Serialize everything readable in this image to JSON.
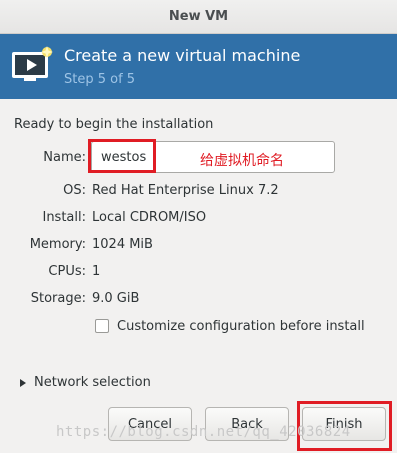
{
  "window": {
    "title": "New VM"
  },
  "banner": {
    "title": "Create a new virtual machine",
    "step": "Step 5 of 5",
    "icon": "monitor-play-icon"
  },
  "summary": {
    "heading": "Ready to begin the installation",
    "name_label": "Name:",
    "name_value": "westos",
    "os_label": "OS:",
    "os_value": "Red Hat Enterprise Linux 7.2",
    "install_label": "Install:",
    "install_value": "Local CDROM/ISO",
    "memory_label": "Memory:",
    "memory_value": "1024 MiB",
    "cpus_label": "CPUs:",
    "cpus_value": "1",
    "storage_label": "Storage:",
    "storage_value": "9.0 GiB"
  },
  "customize": {
    "label": "Customize configuration before install",
    "checked": false
  },
  "network": {
    "label": "Network selection"
  },
  "buttons": {
    "cancel": "Cancel",
    "back": "Back",
    "finish": "Finish"
  },
  "annotation": {
    "text": "给虚拟机命名",
    "color": "#e01c24"
  },
  "watermark": {
    "text": "https://blog.csdn.net/qq_42036824"
  },
  "colors": {
    "banner": "#3070a8",
    "step_text": "#9ec4e6",
    "highlight": "#e01c24"
  }
}
